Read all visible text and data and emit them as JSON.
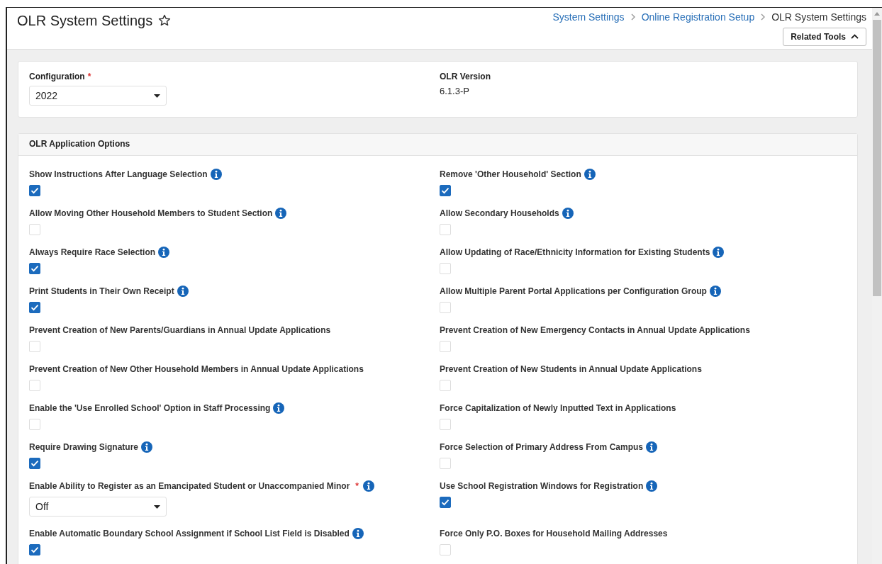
{
  "page": {
    "title": "OLR System Settings",
    "favorite": false
  },
  "breadcrumbs": [
    {
      "label": "System Settings",
      "link": true
    },
    {
      "label": "Online Registration Setup",
      "link": true
    },
    {
      "label": "OLR System Settings",
      "link": false
    }
  ],
  "related_tools": {
    "label": "Related Tools",
    "expanded": true
  },
  "config": {
    "label": "Configuration",
    "required_mark": "*",
    "value": "2022",
    "version_label": "OLR Version",
    "version": "6.1.3-P"
  },
  "section": {
    "title": "OLR Application Options"
  },
  "options": [
    {
      "kind": "checkbox",
      "label": "Show Instructions After Language Selection",
      "info": true,
      "checked": true
    },
    {
      "kind": "checkbox",
      "label": "Remove 'Other Household' Section",
      "info": true,
      "checked": true
    },
    {
      "kind": "checkbox",
      "label": "Allow Moving Other Household Members to Student Section",
      "info": true,
      "checked": false
    },
    {
      "kind": "checkbox",
      "label": "Allow Secondary Households",
      "info": true,
      "checked": false
    },
    {
      "kind": "checkbox",
      "label": "Always Require Race Selection",
      "info": true,
      "checked": true
    },
    {
      "kind": "checkbox",
      "label": "Allow Updating of Race/Ethnicity Information for Existing Students",
      "info": true,
      "checked": false
    },
    {
      "kind": "checkbox",
      "label": "Print Students in Their Own Receipt",
      "info": true,
      "checked": true
    },
    {
      "kind": "checkbox",
      "label": "Allow Multiple Parent Portal Applications per Configuration Group",
      "info": true,
      "checked": false
    },
    {
      "kind": "checkbox",
      "label": "Prevent Creation of New Parents/Guardians in Annual Update Applications",
      "info": false,
      "checked": false
    },
    {
      "kind": "checkbox",
      "label": "Prevent Creation of New Emergency Contacts in Annual Update Applications",
      "info": false,
      "checked": false
    },
    {
      "kind": "checkbox",
      "label": "Prevent Creation of New Other Household Members in Annual Update Applications",
      "info": false,
      "checked": false
    },
    {
      "kind": "checkbox",
      "label": "Prevent Creation of New Students in Annual Update Applications",
      "info": false,
      "checked": false
    },
    {
      "kind": "checkbox",
      "label": "Enable the 'Use Enrolled School' Option in Staff Processing",
      "info": true,
      "checked": false
    },
    {
      "kind": "checkbox",
      "label": "Force Capitalization of Newly Inputted Text in Applications",
      "info": false,
      "checked": false
    },
    {
      "kind": "checkbox",
      "label": "Require Drawing Signature",
      "info": true,
      "checked": true
    },
    {
      "kind": "checkbox",
      "label": "Force Selection of Primary Address From Campus",
      "info": true,
      "checked": false
    },
    {
      "kind": "select",
      "label": "Enable Ability to Register as an Emancipated Student or Unaccompanied Minor",
      "info": true,
      "required_mark": "*",
      "value": "Off"
    },
    {
      "kind": "checkbox",
      "label": "Use School Registration Windows for Registration",
      "info": true,
      "checked": true
    },
    {
      "kind": "checkbox",
      "label": "Enable Automatic Boundary School Assignment if School List Field is Disabled",
      "info": true,
      "checked": true
    },
    {
      "kind": "checkbox",
      "label": "Force Only P.O. Boxes for Household Mailing Addresses",
      "info": false,
      "checked": false
    }
  ]
}
